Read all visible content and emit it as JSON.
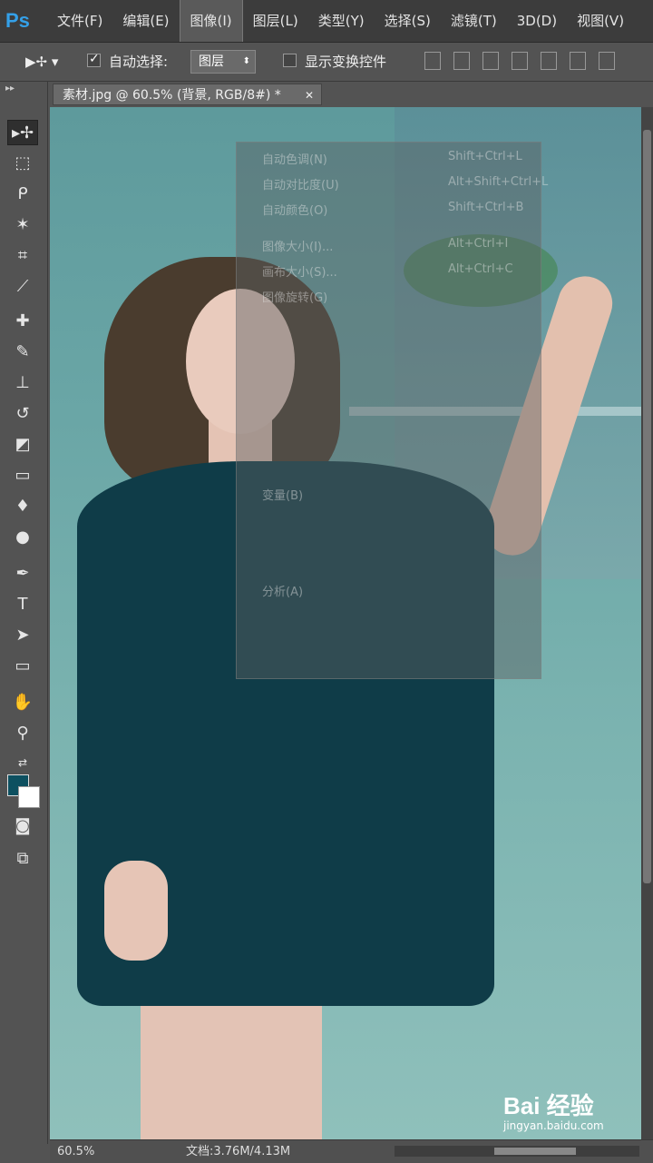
{
  "app": {
    "logo": "Ps"
  },
  "menu": [
    {
      "label": "文件(F)"
    },
    {
      "label": "编辑(E)"
    },
    {
      "label": "图像(I)"
    },
    {
      "label": "图层(L)"
    },
    {
      "label": "类型(Y)"
    },
    {
      "label": "选择(S)"
    },
    {
      "label": "滤镜(T)"
    },
    {
      "label": "3D(D)"
    },
    {
      "label": "视图(V)"
    }
  ],
  "options": {
    "auto_select_label": "自动选择:",
    "auto_select_checked": true,
    "select_value": "图层",
    "show_transform_label": "显示变换控件",
    "show_transform_checked": false
  },
  "document": {
    "tab_title": "素材.jpg @ 60.5% (背景, RGB/8#) *"
  },
  "dropdown_items": [
    {
      "label": "自动色调(N)",
      "shortcut": "Shift+Ctrl+L"
    },
    {
      "label": "自动对比度(U)",
      "shortcut": "Alt+Shift+Ctrl+L"
    },
    {
      "label": "自动颜色(O)",
      "shortcut": "Shift+Ctrl+B"
    },
    {
      "label": "图像大小(I)...",
      "shortcut": "Alt+Ctrl+I"
    },
    {
      "label": "画布大小(S)...",
      "shortcut": "Alt+Ctrl+C"
    },
    {
      "label": "图像旋转(G)",
      "shortcut": ""
    },
    {
      "label": "变量(B)",
      "shortcut": ""
    },
    {
      "label": "分析(A)",
      "shortcut": ""
    }
  ],
  "status": {
    "zoom": "60.5%",
    "doc_info": "文档:3.76M/4.13M"
  },
  "watermark": {
    "logo": "Bai 经验",
    "url": "jingyan.baidu.com"
  }
}
